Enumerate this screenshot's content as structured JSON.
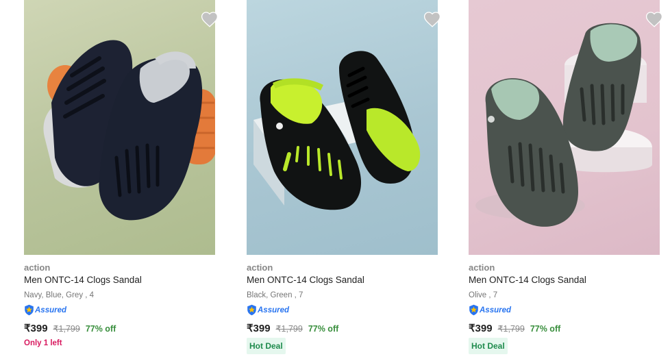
{
  "products": [
    {
      "brand": "action",
      "title": "Men ONTC-14 Clogs Sandal",
      "variant": "Navy, Blue, Grey , 4",
      "assured_label": "Assured",
      "price": "₹399",
      "mrp": "₹1,799",
      "discount": "77% off",
      "tag": "Only 1 left",
      "tag_type": "stock",
      "image_icon": "navy-grey-clog-image",
      "bg_color": "#bcc79f"
    },
    {
      "brand": "action",
      "title": "Men ONTC-14 Clogs Sandal",
      "variant": "Black, Green , 7",
      "assured_label": "Assured",
      "price": "₹399",
      "mrp": "₹1,799",
      "discount": "77% off",
      "tag": "Hot Deal",
      "tag_type": "deal",
      "image_icon": "black-green-clog-image",
      "bg_color": "#a9c6d2"
    },
    {
      "brand": "action",
      "title": "Men ONTC-14 Clogs Sandal",
      "variant": "Olive , 7",
      "assured_label": "Assured",
      "price": "₹399",
      "mrp": "₹1,799",
      "discount": "77% off",
      "tag": "Hot Deal",
      "tag_type": "deal",
      "image_icon": "olive-clog-image",
      "bg_color": "#e3c3ce"
    }
  ],
  "colors": {
    "price_green": "#388e3c",
    "assured_blue": "#2874f0",
    "stock_pink": "#d81b60",
    "deal_bg": "#e5f7ee",
    "heart_grey": "#c2c2c2"
  }
}
